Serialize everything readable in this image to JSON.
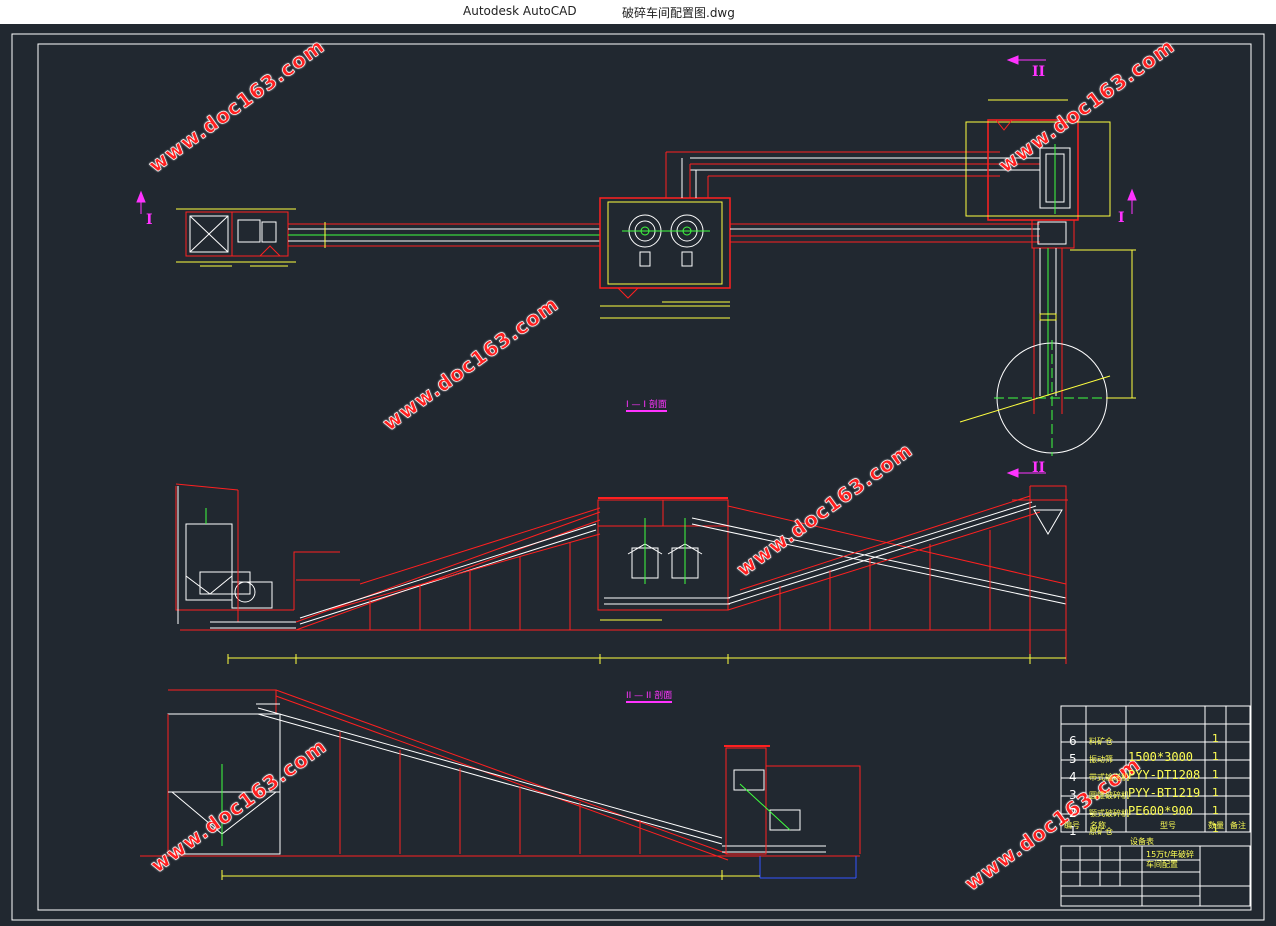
{
  "window": {
    "app_name": "Autodesk AutoCAD",
    "file_name": "破碎车间配置图.dwg"
  },
  "drawing": {
    "watermark": "www.doc163.com",
    "section_1_title": "I — I 剖面",
    "section_2_title": "II — II 剖面",
    "section_mark_1": "I",
    "section_mark_2": "II",
    "colors": {
      "background": "#212830",
      "frame": "#ffffff",
      "structure": "#ff2020",
      "dimension": "#ffff40",
      "equipment": "#ffffff",
      "centerline": "#40ff40",
      "section_mark": "#ff33ff"
    }
  },
  "bom": {
    "rows": [
      {
        "no": "6",
        "name": "料矿仓",
        "spec": "",
        "qty": "1"
      },
      {
        "no": "5",
        "name": "振动筛",
        "spec": "1500*3000",
        "qty": "1"
      },
      {
        "no": "4",
        "name": "带式输送机",
        "spec": "PYY-DT1208",
        "qty": "1"
      },
      {
        "no": "3",
        "name": "圆锥破碎机",
        "spec": "PYY-BT1219",
        "qty": "1"
      },
      {
        "no": "2",
        "name": "颚式破碎机",
        "spec": "PE600*900",
        "qty": "1"
      },
      {
        "no": "1",
        "name": "原矿仓",
        "spec": "",
        "qty": "1"
      }
    ],
    "header": {
      "no": "编号",
      "name": "名称",
      "spec": "型号",
      "qty": "数量",
      "note": "备注"
    },
    "footer_title": "设备表",
    "title_block_name": "15万t/年破碎车间配置"
  }
}
